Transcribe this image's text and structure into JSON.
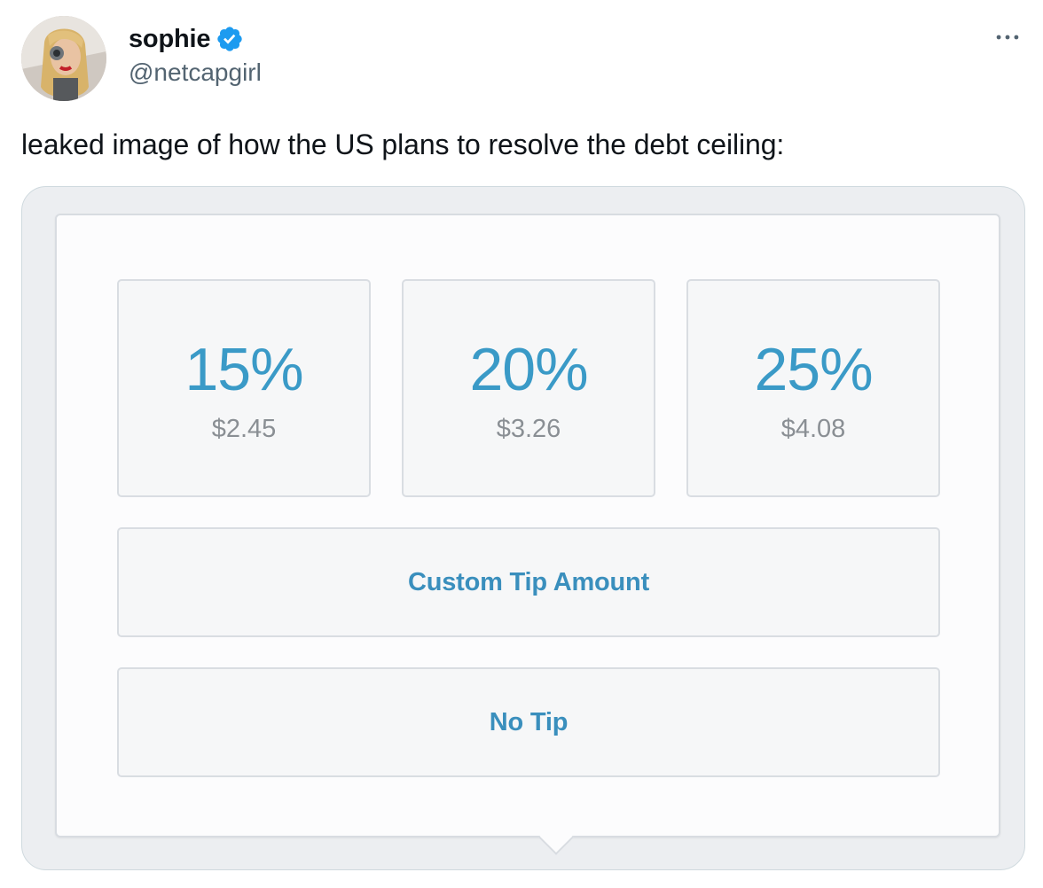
{
  "author": {
    "display_name": "sophie",
    "handle": "@netcapgirl",
    "avatar_icon": "profile-avatar",
    "verified_icon": "verified-badge-icon",
    "verified_color": "#1d9bf0"
  },
  "tweet": {
    "text": "leaked image of how the US plans to resolve the debt ceiling:",
    "more_icon": "more-horizontal-icon"
  },
  "tip_prompt": {
    "accent_color": "#3a9ac7",
    "options": [
      {
        "percent": "15%",
        "amount": "$2.45"
      },
      {
        "percent": "20%",
        "amount": "$3.26"
      },
      {
        "percent": "25%",
        "amount": "$4.08"
      }
    ],
    "custom_label": "Custom Tip Amount",
    "no_tip_label": "No Tip"
  }
}
